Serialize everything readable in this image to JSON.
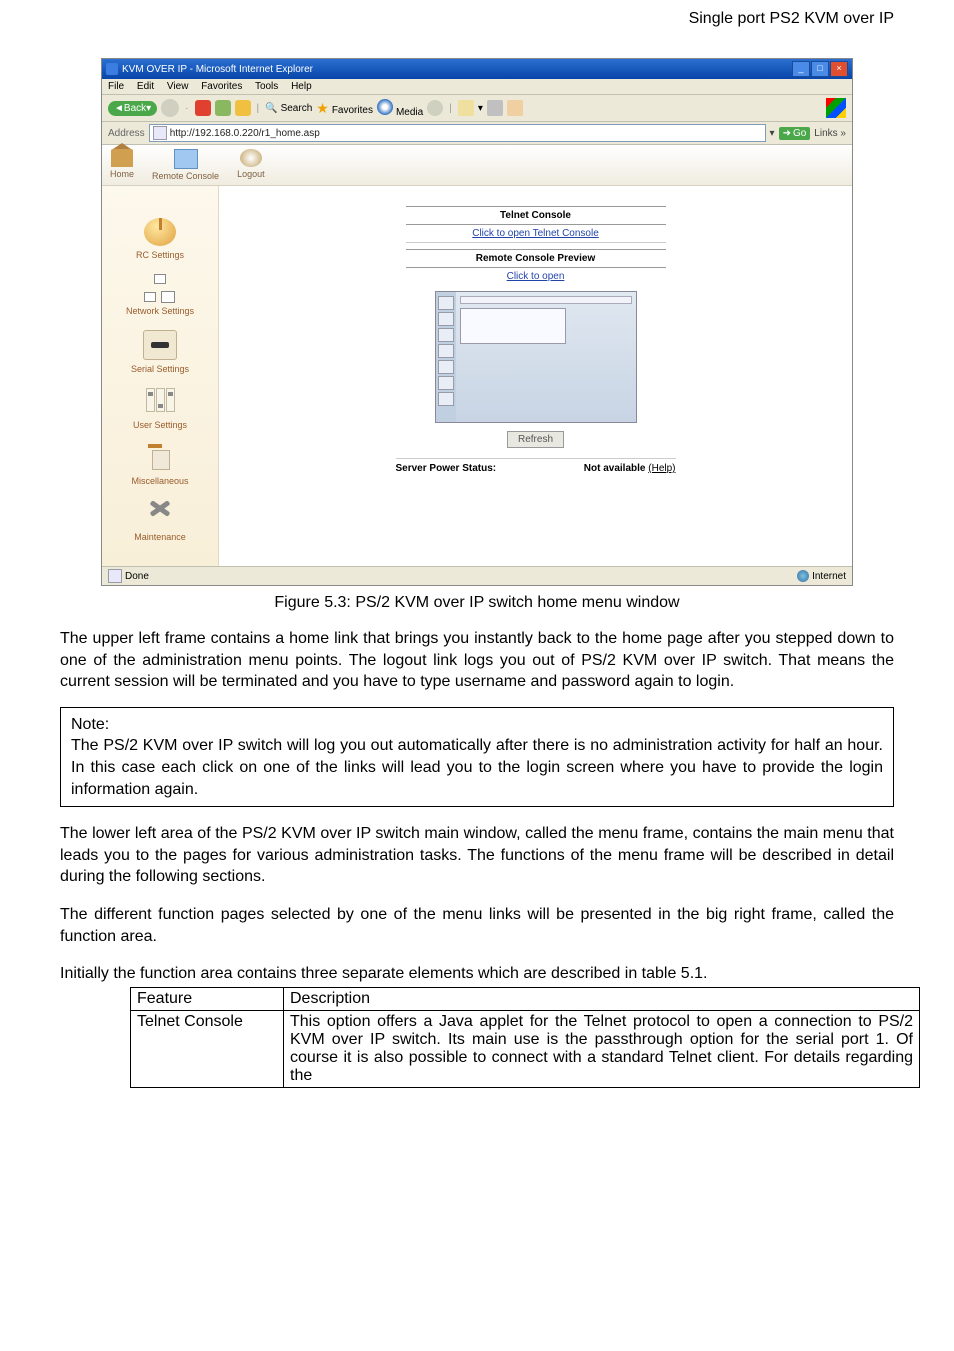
{
  "header_right": "Single port PS2 KVM over IP",
  "browser": {
    "title": "KVM OVER IP - Microsoft Internet Explorer",
    "menu": [
      "File",
      "Edit",
      "View",
      "Favorites",
      "Tools",
      "Help"
    ],
    "toolbar": {
      "back": "Back",
      "search": "Search",
      "favorites": "Favorites",
      "media": "Media"
    },
    "address_label": "Address",
    "url": "http://192.168.0.220/r1_home.asp",
    "go": "Go",
    "links": "Links",
    "status_done": "Done",
    "status_zone": "Internet"
  },
  "top_nav": {
    "home": "Home",
    "remote": "Remote Console",
    "logout": "Logout"
  },
  "sidebar": {
    "rc": "RC Settings",
    "net": "Network Settings",
    "serial": "Serial Settings",
    "user": "User Settings",
    "misc": "Miscellaneous",
    "maint": "Maintenance"
  },
  "main": {
    "telnet_title": "Telnet Console",
    "telnet_link": "Click to open Telnet Console",
    "preview_title": "Remote Console Preview",
    "preview_link": "Click to open",
    "refresh": "Refresh",
    "power_label": "Server Power Status:",
    "power_value": "Not available",
    "help": "(Help)"
  },
  "caption": "Figure 5.3: PS/2 KVM over IP switch home menu window",
  "para1": "The upper left frame contains a home link that brings you instantly back to the home page after you stepped down to one of the administration menu points. The logout link logs you out of PS/2 KVM over IP switch. That means the current session will be terminated and you have to type username and password again to login.",
  "note_label": "Note:",
  "note_body": "The PS/2 KVM over IP switch will log you out automatically after there is no administration activity for half an hour. In this case each click on one of the links will lead you to the login screen where you have to provide the login information again.",
  "para2": "The lower left area of the PS/2 KVM over IP switch main window, called the menu frame, contains the main menu that leads you to the pages for various administration tasks. The functions of the menu frame will be described in detail during the following sections.",
  "para3": "The different function pages selected by one of the menu links will be presented in the big right frame, called the function area.",
  "para4": "Initially the function area contains three separate elements which are described in table 5.1.",
  "table": {
    "h1": "Feature",
    "h2": "Description",
    "r1c1": "Telnet Console",
    "r1c2": "This option offers a Java applet for the Telnet protocol to open a connection to PS/2 KVM over IP switch. Its main use is the passthrough option for the serial port 1. Of course it is also possible to connect with a standard Telnet client. For details regarding the"
  }
}
